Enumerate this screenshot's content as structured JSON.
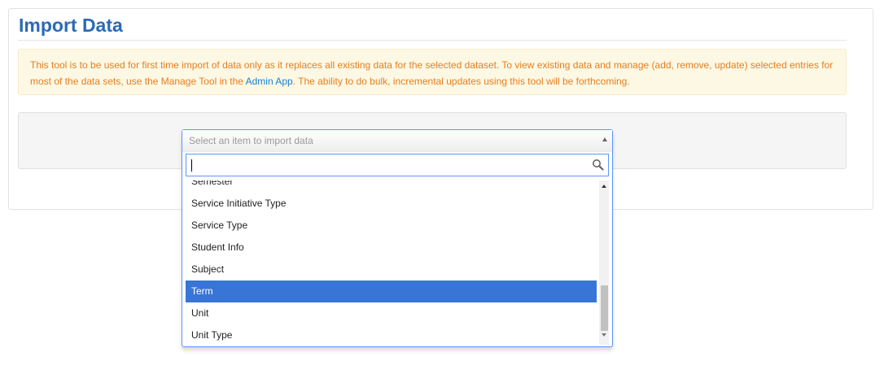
{
  "page": {
    "title": "Import Data"
  },
  "notice": {
    "text_before": "This tool is to be used for first time import of data only as it replaces all existing data for the selected dataset. To view existing data and manage (add, remove, update) selected entries for most of the data sets, use the Manage Tool in the ",
    "link_text": "Admin App",
    "text_after": ". The ability to do bulk, incremental updates using this tool will be forthcoming."
  },
  "select": {
    "placeholder": "Select an item to import data",
    "search_value": "",
    "arrow_icon": "chevron-up-icon",
    "search_icon": "search-icon",
    "partial_item": "Semester",
    "items": [
      {
        "label": "Service Initiative Type"
      },
      {
        "label": "Service Type"
      },
      {
        "label": "Student Info"
      },
      {
        "label": "Subject"
      },
      {
        "label": "Term"
      },
      {
        "label": "Unit"
      },
      {
        "label": "Unit Type"
      }
    ],
    "highlighted": "Term"
  },
  "colors": {
    "title": "#2a6ab8",
    "notice_text": "#e67e22",
    "notice_bg": "#fcf8e3",
    "link": "#1a7fd1",
    "highlight_bg": "#3875d7",
    "focus_border": "#5897fb"
  }
}
